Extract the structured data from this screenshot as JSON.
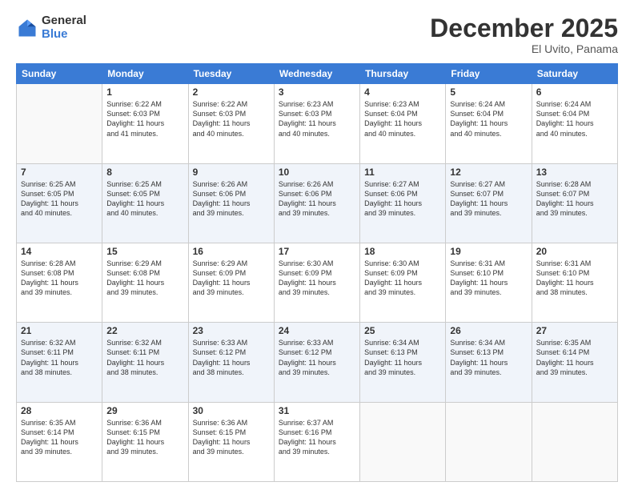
{
  "logo": {
    "general": "General",
    "blue": "Blue"
  },
  "title": "December 2025",
  "subtitle": "El Uvito, Panama",
  "headers": [
    "Sunday",
    "Monday",
    "Tuesday",
    "Wednesday",
    "Thursday",
    "Friday",
    "Saturday"
  ],
  "weeks": [
    [
      {
        "day": "",
        "info": ""
      },
      {
        "day": "1",
        "info": "Sunrise: 6:22 AM\nSunset: 6:03 PM\nDaylight: 11 hours\nand 41 minutes."
      },
      {
        "day": "2",
        "info": "Sunrise: 6:22 AM\nSunset: 6:03 PM\nDaylight: 11 hours\nand 40 minutes."
      },
      {
        "day": "3",
        "info": "Sunrise: 6:23 AM\nSunset: 6:03 PM\nDaylight: 11 hours\nand 40 minutes."
      },
      {
        "day": "4",
        "info": "Sunrise: 6:23 AM\nSunset: 6:04 PM\nDaylight: 11 hours\nand 40 minutes."
      },
      {
        "day": "5",
        "info": "Sunrise: 6:24 AM\nSunset: 6:04 PM\nDaylight: 11 hours\nand 40 minutes."
      },
      {
        "day": "6",
        "info": "Sunrise: 6:24 AM\nSunset: 6:04 PM\nDaylight: 11 hours\nand 40 minutes."
      }
    ],
    [
      {
        "day": "7",
        "info": "Sunrise: 6:25 AM\nSunset: 6:05 PM\nDaylight: 11 hours\nand 40 minutes."
      },
      {
        "day": "8",
        "info": "Sunrise: 6:25 AM\nSunset: 6:05 PM\nDaylight: 11 hours\nand 40 minutes."
      },
      {
        "day": "9",
        "info": "Sunrise: 6:26 AM\nSunset: 6:06 PM\nDaylight: 11 hours\nand 39 minutes."
      },
      {
        "day": "10",
        "info": "Sunrise: 6:26 AM\nSunset: 6:06 PM\nDaylight: 11 hours\nand 39 minutes."
      },
      {
        "day": "11",
        "info": "Sunrise: 6:27 AM\nSunset: 6:06 PM\nDaylight: 11 hours\nand 39 minutes."
      },
      {
        "day": "12",
        "info": "Sunrise: 6:27 AM\nSunset: 6:07 PM\nDaylight: 11 hours\nand 39 minutes."
      },
      {
        "day": "13",
        "info": "Sunrise: 6:28 AM\nSunset: 6:07 PM\nDaylight: 11 hours\nand 39 minutes."
      }
    ],
    [
      {
        "day": "14",
        "info": "Sunrise: 6:28 AM\nSunset: 6:08 PM\nDaylight: 11 hours\nand 39 minutes."
      },
      {
        "day": "15",
        "info": "Sunrise: 6:29 AM\nSunset: 6:08 PM\nDaylight: 11 hours\nand 39 minutes."
      },
      {
        "day": "16",
        "info": "Sunrise: 6:29 AM\nSunset: 6:09 PM\nDaylight: 11 hours\nand 39 minutes."
      },
      {
        "day": "17",
        "info": "Sunrise: 6:30 AM\nSunset: 6:09 PM\nDaylight: 11 hours\nand 39 minutes."
      },
      {
        "day": "18",
        "info": "Sunrise: 6:30 AM\nSunset: 6:09 PM\nDaylight: 11 hours\nand 39 minutes."
      },
      {
        "day": "19",
        "info": "Sunrise: 6:31 AM\nSunset: 6:10 PM\nDaylight: 11 hours\nand 39 minutes."
      },
      {
        "day": "20",
        "info": "Sunrise: 6:31 AM\nSunset: 6:10 PM\nDaylight: 11 hours\nand 38 minutes."
      }
    ],
    [
      {
        "day": "21",
        "info": "Sunrise: 6:32 AM\nSunset: 6:11 PM\nDaylight: 11 hours\nand 38 minutes."
      },
      {
        "day": "22",
        "info": "Sunrise: 6:32 AM\nSunset: 6:11 PM\nDaylight: 11 hours\nand 38 minutes."
      },
      {
        "day": "23",
        "info": "Sunrise: 6:33 AM\nSunset: 6:12 PM\nDaylight: 11 hours\nand 38 minutes."
      },
      {
        "day": "24",
        "info": "Sunrise: 6:33 AM\nSunset: 6:12 PM\nDaylight: 11 hours\nand 39 minutes."
      },
      {
        "day": "25",
        "info": "Sunrise: 6:34 AM\nSunset: 6:13 PM\nDaylight: 11 hours\nand 39 minutes."
      },
      {
        "day": "26",
        "info": "Sunrise: 6:34 AM\nSunset: 6:13 PM\nDaylight: 11 hours\nand 39 minutes."
      },
      {
        "day": "27",
        "info": "Sunrise: 6:35 AM\nSunset: 6:14 PM\nDaylight: 11 hours\nand 39 minutes."
      }
    ],
    [
      {
        "day": "28",
        "info": "Sunrise: 6:35 AM\nSunset: 6:14 PM\nDaylight: 11 hours\nand 39 minutes."
      },
      {
        "day": "29",
        "info": "Sunrise: 6:36 AM\nSunset: 6:15 PM\nDaylight: 11 hours\nand 39 minutes."
      },
      {
        "day": "30",
        "info": "Sunrise: 6:36 AM\nSunset: 6:15 PM\nDaylight: 11 hours\nand 39 minutes."
      },
      {
        "day": "31",
        "info": "Sunrise: 6:37 AM\nSunset: 6:16 PM\nDaylight: 11 hours\nand 39 minutes."
      },
      {
        "day": "",
        "info": ""
      },
      {
        "day": "",
        "info": ""
      },
      {
        "day": "",
        "info": ""
      }
    ]
  ]
}
